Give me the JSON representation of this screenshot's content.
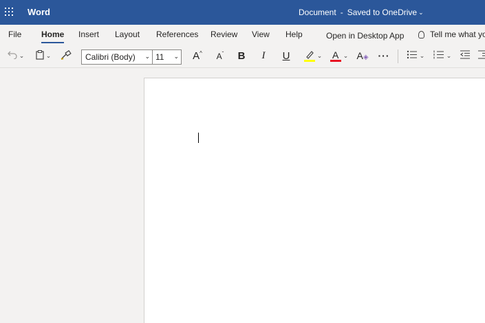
{
  "app": {
    "name": "Word"
  },
  "document": {
    "title": "Document",
    "separator": "-",
    "status": "Saved to OneDrive"
  },
  "menu": {
    "tabs": [
      {
        "label": "File"
      },
      {
        "label": "Home"
      },
      {
        "label": "Insert"
      },
      {
        "label": "Layout"
      },
      {
        "label": "References"
      },
      {
        "label": "Review"
      },
      {
        "label": "View"
      },
      {
        "label": "Help"
      },
      {
        "label": "Open in Desktop App"
      }
    ],
    "active_tab": "Home",
    "tell_me": "Tell me what yo"
  },
  "toolbar": {
    "font_name": "Calibri (Body)",
    "font_size": "11",
    "bold": "B",
    "italic": "I",
    "underline": "U",
    "font_color_letter": "A",
    "more": "···",
    "icons": [
      "undo-icon",
      "paste-icon",
      "format-painter-icon",
      "grow-font-icon",
      "shrink-font-icon",
      "highlight-icon",
      "font-color-icon",
      "styles-icon",
      "bullets-icon",
      "numbering-icon",
      "decrease-indent-icon",
      "increase-indent-icon"
    ],
    "highlight_color": "#ffff00",
    "font_color": "#e81123"
  },
  "colors": {
    "brand": "#2b579a"
  }
}
